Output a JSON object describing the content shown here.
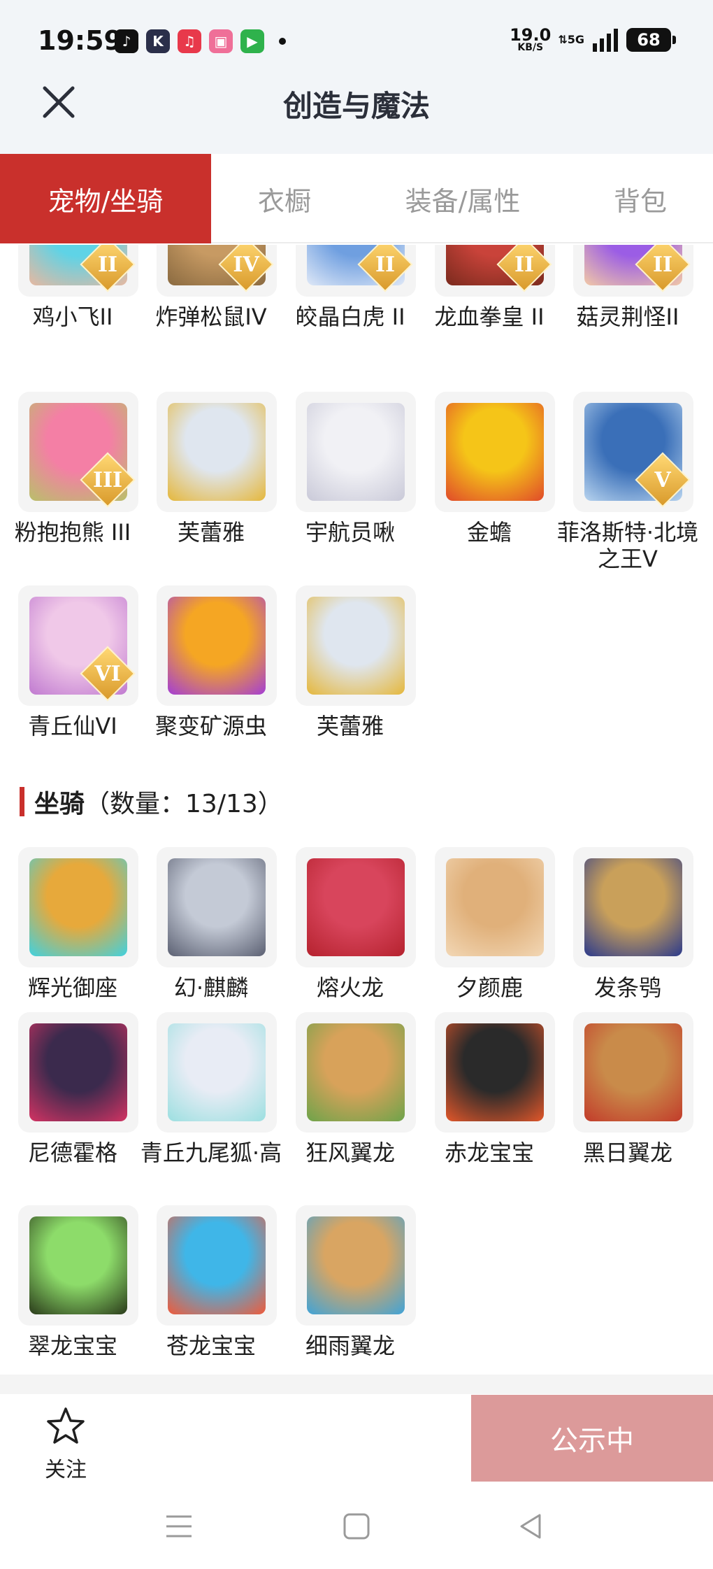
{
  "status_bar": {
    "time": "19:59",
    "apps": [
      {
        "icon": "tiktok-icon",
        "glyph": "♪",
        "color": "#111111"
      },
      {
        "icon": "kuaishou-icon",
        "glyph": "K",
        "color": "#2b2f4a"
      },
      {
        "icon": "music-icon",
        "glyph": "♫",
        "color": "#e8394b"
      },
      {
        "icon": "bilibili-icon",
        "glyph": "▣",
        "color": "#ef6f98"
      },
      {
        "icon": "video-app-icon",
        "glyph": "▶",
        "color": "#2fb24c"
      }
    ],
    "net_speed": "19.0",
    "net_unit": "KB/S",
    "network": "5G",
    "battery": "68"
  },
  "header": {
    "title": "创造与魔法"
  },
  "tabs": [
    {
      "label": "宠物/坐骑",
      "active": true
    },
    {
      "label": "衣橱",
      "active": false
    },
    {
      "label": "装备/属性",
      "active": false
    },
    {
      "label": "背包",
      "active": false
    }
  ],
  "pets": [
    {
      "name": "鸡小飞II",
      "badge": "II",
      "color1": "#5fd3e6",
      "color2": "#e8b8a0"
    },
    {
      "name": "炸弹松鼠IV",
      "badge": "IV",
      "color1": "#c79a63",
      "color2": "#8a6a40"
    },
    {
      "name": "皎晶白虎 II",
      "badge": "II",
      "color1": "#6f9fe0",
      "color2": "#dfe8f7"
    },
    {
      "name": "龙血拳皇 II",
      "badge": "II",
      "color1": "#c9433a",
      "color2": "#7a2a1d"
    },
    {
      "name": "菇灵荆怪II",
      "badge": "II",
      "color1": "#9b5de5",
      "color2": "#f2c9a6"
    },
    {
      "name": "粉抱抱熊 III",
      "badge": "III",
      "color1": "#f47fa5",
      "color2": "#b9c06a"
    },
    {
      "name": "芙蕾雅",
      "badge": "",
      "color1": "#dfe6ef",
      "color2": "#e5b73b"
    },
    {
      "name": "宇航员啾",
      "badge": "",
      "color1": "#f1f1f5",
      "color2": "#c9c9d8"
    },
    {
      "name": "金蟾",
      "badge": "",
      "color1": "#f5c518",
      "color2": "#e04a2a"
    },
    {
      "name": "菲洛斯特·北境之王V",
      "badge": "V",
      "color1": "#3a6fb8",
      "color2": "#b8d4ef"
    },
    {
      "name": "青丘仙VI",
      "badge": "VI",
      "color1": "#f0c8e8",
      "color2": "#c07ad0"
    },
    {
      "name": "聚变矿源虫",
      "badge": "",
      "color1": "#f5a623",
      "color2": "#a33dd6"
    },
    {
      "name": "芙蕾雅",
      "badge": "",
      "color1": "#dfe6ef",
      "color2": "#e5b73b"
    }
  ],
  "mounts_section": {
    "title": "坐骑",
    "count": "（数量：13/13）"
  },
  "mounts": [
    {
      "name": "辉光御座",
      "color1": "#e7a93b",
      "color2": "#3fd1e0"
    },
    {
      "name": "幻·麒麟",
      "color1": "#c4cad6",
      "color2": "#5b6072"
    },
    {
      "name": "熔火龙",
      "color1": "#d8455c",
      "color2": "#b5222e"
    },
    {
      "name": "夕颜鹿",
      "color1": "#e0b07a",
      "color2": "#f2d7b5"
    },
    {
      "name": "发条鸮",
      "color1": "#c9a05a",
      "color2": "#2b3a8c"
    },
    {
      "name": "尼德霍格",
      "color1": "#3b2a4d",
      "color2": "#d43363"
    },
    {
      "name": "青丘九尾狐·高",
      "color1": "#e8ecf5",
      "color2": "#9bdfe0"
    },
    {
      "name": "狂风翼龙",
      "color1": "#d8a25a",
      "color2": "#6da34a"
    },
    {
      "name": "赤龙宝宝",
      "color1": "#2a2a2a",
      "color2": "#e3572a"
    },
    {
      "name": "黑日翼龙",
      "color1": "#c98b4a",
      "color2": "#c23b2a"
    },
    {
      "name": "翠龙宝宝",
      "color1": "#8ddc6a",
      "color2": "#2a3a1a"
    },
    {
      "name": "苍龙宝宝",
      "color1": "#3fb6e8",
      "color2": "#f05a3a"
    },
    {
      "name": "细雨翼龙",
      "color1": "#d9a562",
      "color2": "#3fa3d8"
    }
  ],
  "bottom": {
    "follow_label": "关注",
    "status_label": "公示中"
  },
  "colors": {
    "accent": "#c9302c",
    "status_button": "#dc9a9a"
  }
}
